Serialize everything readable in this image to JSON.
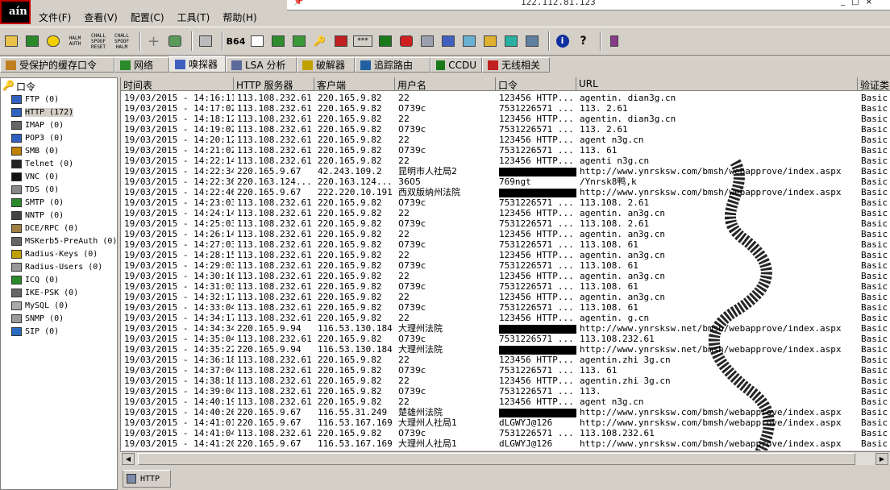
{
  "app": {
    "logo": "aín"
  },
  "remote": {
    "ip": "122.112.81.123"
  },
  "menu": [
    "文件(F)",
    "查看(V)",
    "配置(C)",
    "工具(T)",
    "帮助(H)"
  ],
  "toolbar": {
    "halm_label": "HALM\nAUTH",
    "chall1_label": "CHALL\nSPOOF\nRESET",
    "chall2_label": "CHALL\nSPOOF\nHALM",
    "b64_label": "B64",
    "stars_label": "***"
  },
  "tabs": [
    "受保护的缓存口令",
    "网络",
    "嗅探器",
    "LSA 分析",
    "破解器",
    "追踪路由",
    "CCDU",
    "无线相关"
  ],
  "tree": {
    "root": "口令",
    "items": [
      "FTP  (0)",
      "HTTP  (172)",
      "IMAP  (0)",
      "POP3  (0)",
      "SMB  (0)",
      "Telnet  (0)",
      "VNC  (0)",
      "TDS  (0)",
      "SMTP  (0)",
      "NNTP  (0)",
      "DCE/RPC  (0)",
      "MSKerb5-PreAuth  (0)",
      "Radius-Keys  (0)",
      "Radius-Users  (0)",
      "ICQ  (0)",
      "IKE-PSK  (0)",
      "MySQL  (0)",
      "SNMP  (0)",
      "SIP  (0)"
    ]
  },
  "table": {
    "columns": [
      "时间表",
      "HTTP 服务器",
      "客户端",
      "用户名",
      "口令",
      "URL",
      "验证类"
    ],
    "rows": [
      [
        "19/03/2015 - 14:16:11",
        "113.108.232.61",
        "220.165.9.82",
        "22",
        "123456 HTTP...",
        "agentin.  dian3g.cn",
        "Basic"
      ],
      [
        "19/03/2015 - 14:17:02",
        "113.108.232.61",
        "220.165.9.82",
        "0739c",
        "7531226571 ...",
        "113.  2.61",
        "Basic"
      ],
      [
        "19/03/2015 - 14:18:12",
        "113.108.232.61",
        "220.165.9.82",
        "22",
        "123456 HTTP...",
        "agentin.  dian3g.cn",
        "Basic"
      ],
      [
        "19/03/2015 - 14:19:02",
        "113.108.232.61",
        "220.165.9.82",
        "0739c",
        "7531226571 ...",
        "113.  2.61",
        "Basic"
      ],
      [
        "19/03/2015 - 14:20:12",
        "113.108.232.61",
        "220.165.9.82",
        "22",
        "123456 HTTP...",
        "agent  n3g.cn",
        "Basic"
      ],
      [
        "19/03/2015 - 14:21:02",
        "113.108.232.61",
        "220.165.9.82",
        "0739c",
        "7531226571 ...",
        "113.  61",
        "Basic"
      ],
      [
        "19/03/2015 - 14:22:14",
        "113.108.232.61",
        "220.165.9.82",
        "22",
        "123456 HTTP...",
        "agenti  n3g.cn",
        "Basic"
      ],
      [
        "19/03/2015 - 14:22:34",
        "220.165.9.67",
        "42.243.109.2",
        "昆明市人社局2",
        "",
        "http://www.ynrsksw.com/bmsh/webapprove/index.aspx",
        "Basic"
      ],
      [
        "19/03/2015 - 14:22:36",
        "220.163.124...",
        "220.163.124...",
        "3605",
        "769ngt",
        "/Ynrsk8鸭,k",
        "Basic"
      ],
      [
        "19/03/2015 - 14:22:46",
        "220.165.9.67",
        "222.220.10.191",
        "西双版纳州法院",
        "",
        "http://www.ynrsksw.com/bmsh/webapprove/index.aspx",
        "Basic"
      ],
      [
        "19/03/2015 - 14:23:03",
        "113.108.232.61",
        "220.165.9.82",
        "0739c",
        "7531226571 ...",
        "113.108.  2.61",
        "Basic"
      ],
      [
        "19/03/2015 - 14:24:14",
        "113.108.232.61",
        "220.165.9.82",
        "22",
        "123456 HTTP...",
        "agentin.  an3g.cn",
        "Basic"
      ],
      [
        "19/03/2015 - 14:25:03",
        "113.108.232.61",
        "220.165.9.82",
        "0739c",
        "7531226571 ...",
        "113.108.  2.61",
        "Basic"
      ],
      [
        "19/03/2015 - 14:26:14",
        "113.108.232.61",
        "220.165.9.82",
        "22",
        "123456 HTTP...",
        "agentin.  an3g.cn",
        "Basic"
      ],
      [
        "19/03/2015 - 14:27:03",
        "113.108.232.61",
        "220.165.9.82",
        "0739c",
        "7531226571 ...",
        "113.108.  61",
        "Basic"
      ],
      [
        "19/03/2015 - 14:28:15",
        "113.108.232.61",
        "220.165.9.82",
        "22",
        "123456 HTTP...",
        "agentin.  an3g.cn",
        "Basic"
      ],
      [
        "19/03/2015 - 14:29:03",
        "113.108.232.61",
        "220.165.9.82",
        "0739c",
        "7531226571 ...",
        "113.108.  61",
        "Basic"
      ],
      [
        "19/03/2015 - 14:30:16",
        "113.108.232.61",
        "220.165.9.82",
        "22",
        "123456 HTTP...",
        "agentin.  an3g.cn",
        "Basic"
      ],
      [
        "19/03/2015 - 14:31:03",
        "113.108.232.61",
        "220.165.9.82",
        "0739c",
        "7531226571 ...",
        "113.108.  61",
        "Basic"
      ],
      [
        "19/03/2015 - 14:32:17",
        "113.108.232.61",
        "220.165.9.82",
        "22",
        "123456 HTTP...",
        "agentin.  an3g.cn",
        "Basic"
      ],
      [
        "19/03/2015 - 14:33:04",
        "113.108.232.61",
        "220.165.9.82",
        "0739c",
        "7531226571 ...",
        "113.108.  61",
        "Basic"
      ],
      [
        "19/03/2015 - 14:34:17",
        "113.108.232.61",
        "220.165.9.82",
        "22",
        "123456 HTTP...",
        "agentin.  g.cn",
        "Basic"
      ],
      [
        "19/03/2015 - 14:34:34",
        "220.165.9.94",
        "116.53.130.184",
        "大理州法院",
        "",
        "http://www.ynrsksw.net/bmsh/webapprove/index.aspx",
        "Basic"
      ],
      [
        "19/03/2015 - 14:35:04",
        "113.108.232.61",
        "220.165.9.82",
        "0739c",
        "7531226571 ...",
        "113.108.232.61",
        "Basic"
      ],
      [
        "19/03/2015 - 14:35:22",
        "220.165.9.94",
        "116.53.130.184",
        "大理州法院",
        "",
        "http://www.ynrsksw.net/bmsh/webapprove/index.aspx",
        "Basic"
      ],
      [
        "19/03/2015 - 14:36:18",
        "113.108.232.61",
        "220.165.9.82",
        "22",
        "123456 HTTP...",
        "agentin.zhi  3g.cn",
        "Basic"
      ],
      [
        "19/03/2015 - 14:37:04",
        "113.108.232.61",
        "220.165.9.82",
        "0739c",
        "7531226571 ...",
        "113.  61",
        "Basic"
      ],
      [
        "19/03/2015 - 14:38:18",
        "113.108.232.61",
        "220.165.9.82",
        "22",
        "123456 HTTP...",
        "agentin.zhi  3g.cn",
        "Basic"
      ],
      [
        "19/03/2015 - 14:39:04",
        "113.108.232.61",
        "220.165.9.82",
        "0739c",
        "7531226571 ...",
        "113.",
        "Basic"
      ],
      [
        "19/03/2015 - 14:40:19",
        "113.108.232.61",
        "220.165.9.82",
        "22",
        "123456 HTTP...",
        "agent  n3g.cn",
        "Basic"
      ],
      [
        "19/03/2015 - 14:40:26",
        "220.165.9.67",
        "116.55.31.249",
        "楚雄州法院",
        "",
        "http://www.ynrsksw.com/bmsh/webapprove/index.aspx",
        "Basic"
      ],
      [
        "19/03/2015 - 14:41:01",
        "220.165.9.67",
        "116.53.167.169",
        "大理州人社局1",
        "dLGWYJ@126",
        "http://www.ynrsksw.com/bmsh/webapprove/index.aspx",
        "Basic"
      ],
      [
        "19/03/2015 - 14:41:04",
        "113.108.232.61",
        "220.165.9.82",
        "0739c",
        "7531226571 ...",
        "113.108.232.61",
        "Basic"
      ],
      [
        "19/03/2015 - 14:41:20",
        "220.165.9.67",
        "116.53.167.169",
        "大理州人社局1",
        "dLGWYJ@126",
        "http://www.ynrsksw.com/bmsh/webapprove/index.aspx",
        "Basic"
      ]
    ]
  },
  "bottom_tab": "HTTP"
}
